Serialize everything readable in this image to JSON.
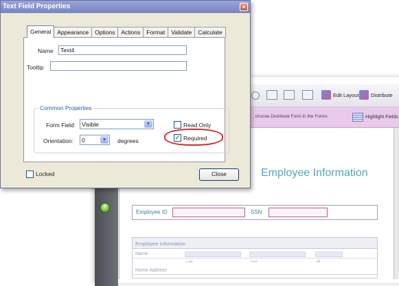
{
  "dialog": {
    "title": "Text Field Properties",
    "close_symbol": "×",
    "tabs": [
      {
        "label": "General",
        "active": true
      },
      {
        "label": "Appearance",
        "active": false
      },
      {
        "label": "Options",
        "active": false
      },
      {
        "label": "Actions",
        "active": false
      },
      {
        "label": "Format",
        "active": false
      },
      {
        "label": "Validate",
        "active": false
      },
      {
        "label": "Calculate",
        "active": false
      }
    ],
    "name_label": "Name",
    "name_value": "Text4",
    "tooltip_label": "Tooltip",
    "tooltip_value": "",
    "common_properties": {
      "title": "Common Properties",
      "form_field_label": "Form Field:",
      "form_field_value": "Visible",
      "orientation_label": "Orientation:",
      "orientation_value": "0",
      "degrees_label": "degrees",
      "read_only_label": "Read Only",
      "read_only_checked": false,
      "required_label": "Required",
      "required_checked": true
    },
    "locked_label": "Locked",
    "locked_checked": false,
    "close_button": "Close",
    "highlight_color": "#d22a2a"
  },
  "background_app": {
    "toolbar": {
      "edit_layout": "Edit Layout",
      "distribute": "Distribute"
    },
    "forms_bar": {
      "message": ", choose Distribute Form in the Forms",
      "highlight_fields": "Highlight Fields",
      "color": "#e9c9ec"
    },
    "page": {
      "title": "Employee Information",
      "employee_id_label": "Employee ID",
      "ssn_label": "SSN",
      "section_title": "Employee Information",
      "name_label": "Name",
      "sublabels": [
        "Last",
        "First",
        "MI"
      ],
      "home_address_label": "Home Address"
    }
  }
}
